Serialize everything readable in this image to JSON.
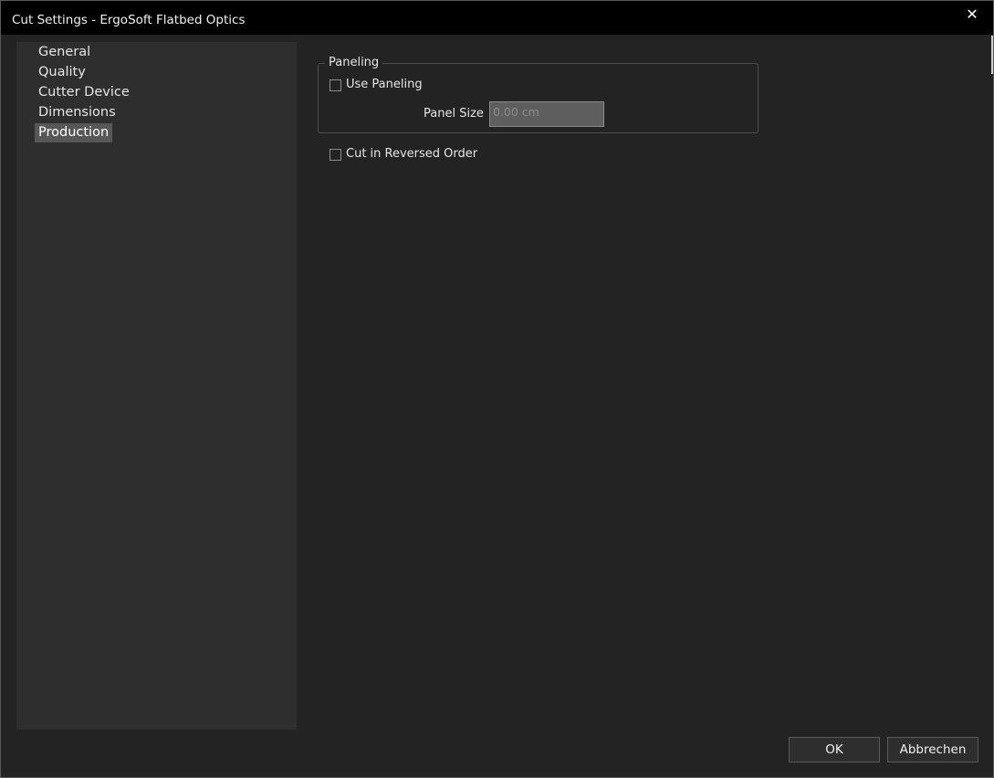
{
  "window": {
    "title": "Cut Settings - ErgoSoft Flatbed Optics",
    "close_symbol": "✕"
  },
  "sidebar": {
    "items": [
      {
        "label": "General"
      },
      {
        "label": "Quality"
      },
      {
        "label": "Cutter Device"
      },
      {
        "label": "Dimensions"
      },
      {
        "label": "Production"
      }
    ],
    "selected": "Production"
  },
  "paneling": {
    "group_title": "Paneling",
    "use_paneling_label": "Use Paneling",
    "use_paneling_checked": false,
    "panel_size_label": "Panel Size",
    "panel_size_placeholder": "0.00 cm"
  },
  "reversed": {
    "label": "Cut in Reversed Order",
    "checked": false
  },
  "buttons": {
    "ok_label": "OK",
    "cancel_label": "Abbrechen"
  },
  "colors": {
    "titlebar": "#000000",
    "background": "#232323",
    "sidebar": "#2e2e2e",
    "selected": "#575757"
  }
}
